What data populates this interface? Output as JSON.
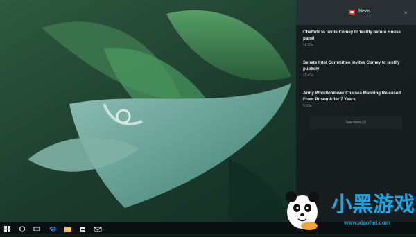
{
  "flyout": {
    "title": "News",
    "stories": [
      {
        "title": "Chaffetz to invite Comey to testify before House panel",
        "time": "11:50a"
      },
      {
        "title": "Senate Intel Committee invites Comey to testify publicly",
        "time": "11:43a"
      },
      {
        "title": "Army Whistleblower Chelsea Manning Released From Prison After 7 Years",
        "time": "5:20a"
      }
    ],
    "see_more": "See more (2)",
    "close_glyph": "×"
  },
  "taskbar": {
    "icons": [
      "windows-start-icon",
      "cortana-circle-icon",
      "task-view-icon",
      "edge-browser-icon",
      "file-explorer-icon",
      "store-icon",
      "mail-icon"
    ]
  },
  "watermark": {
    "text": "小黑游戏",
    "url": "www.xiaohei.com"
  },
  "colors": {
    "flyout_bg": "#181c1e",
    "header_bg": "#2b3034",
    "news_red": "#d9352b",
    "taskbar_bg": "#0a0f12",
    "watermark_blue": "#1aa7e6"
  }
}
